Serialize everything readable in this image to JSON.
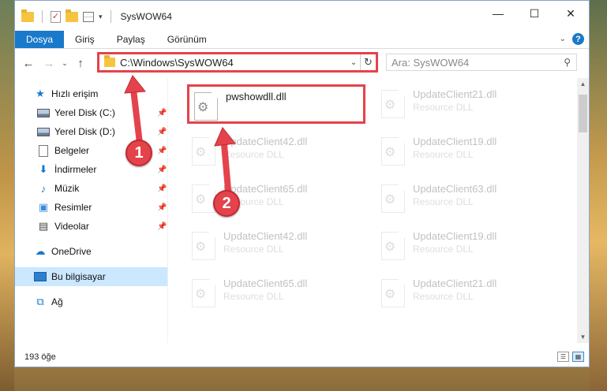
{
  "window": {
    "title": "SysWOW64"
  },
  "titlebar": {
    "minimize_icon": "minimize-icon",
    "maximize_icon": "maximize-icon",
    "close_icon": "close-icon",
    "minimize": "—",
    "maximize": "☐",
    "close": "✕"
  },
  "ribbon": {
    "tabs": [
      {
        "label": "Dosya",
        "active": true
      },
      {
        "label": "Giriş"
      },
      {
        "label": "Paylaş"
      },
      {
        "label": "Görünüm"
      }
    ],
    "help": "?"
  },
  "address": {
    "path": "C:\\Windows\\SysWOW64",
    "search_placeholder": "Ara: SysWOW64"
  },
  "sidebar": {
    "items": [
      {
        "label": "Hızlı erişim",
        "icon": "star-icon"
      },
      {
        "label": "Yerel Disk (C:)",
        "icon": "drive-icon",
        "pinned": true
      },
      {
        "label": "Yerel Disk (D:)",
        "icon": "drive-icon",
        "pinned": true
      },
      {
        "label": "Belgeler",
        "icon": "documents-icon",
        "pinned": true
      },
      {
        "label": "İndirmeler",
        "icon": "downloads-icon",
        "pinned": true
      },
      {
        "label": "Müzik",
        "icon": "music-icon",
        "pinned": true
      },
      {
        "label": "Resimler",
        "icon": "pictures-icon",
        "pinned": true
      },
      {
        "label": "Videolar",
        "icon": "videos-icon",
        "pinned": true
      },
      {
        "label": "OneDrive",
        "icon": "onedrive-icon"
      },
      {
        "label": "Bu bilgisayar",
        "icon": "computer-icon",
        "selected": true
      },
      {
        "label": "Ağ",
        "icon": "network-icon"
      }
    ]
  },
  "files": [
    {
      "name": "pwshowdll.dll",
      "type": ""
    },
    {
      "name": "UpdateClient21.dll",
      "type": "Resource DLL"
    },
    {
      "name": "UpdateClient42.dll",
      "type": "Resource DLL"
    },
    {
      "name": "UpdateClient19.dll",
      "type": "Resource DLL"
    },
    {
      "name": "UpdateClient65.dll",
      "type": "Resource DLL"
    },
    {
      "name": "UpdateClient63.dll",
      "type": "Resource DLL"
    },
    {
      "name": "UpdateClient42.dll",
      "type": "Resource DLL"
    },
    {
      "name": "UpdateClient19.dll",
      "type": "Resource DLL"
    },
    {
      "name": "UpdateClient65.dll",
      "type": "Resource DLL"
    },
    {
      "name": "UpdateClient21.dll",
      "type": "Resource DLL"
    }
  ],
  "status": {
    "count": "193 öğe"
  },
  "annotations": {
    "marker1": "1",
    "marker2": "2"
  },
  "colors": {
    "accent": "#1979ca",
    "annotation": "#e4434b",
    "selection": "#cce8ff"
  }
}
